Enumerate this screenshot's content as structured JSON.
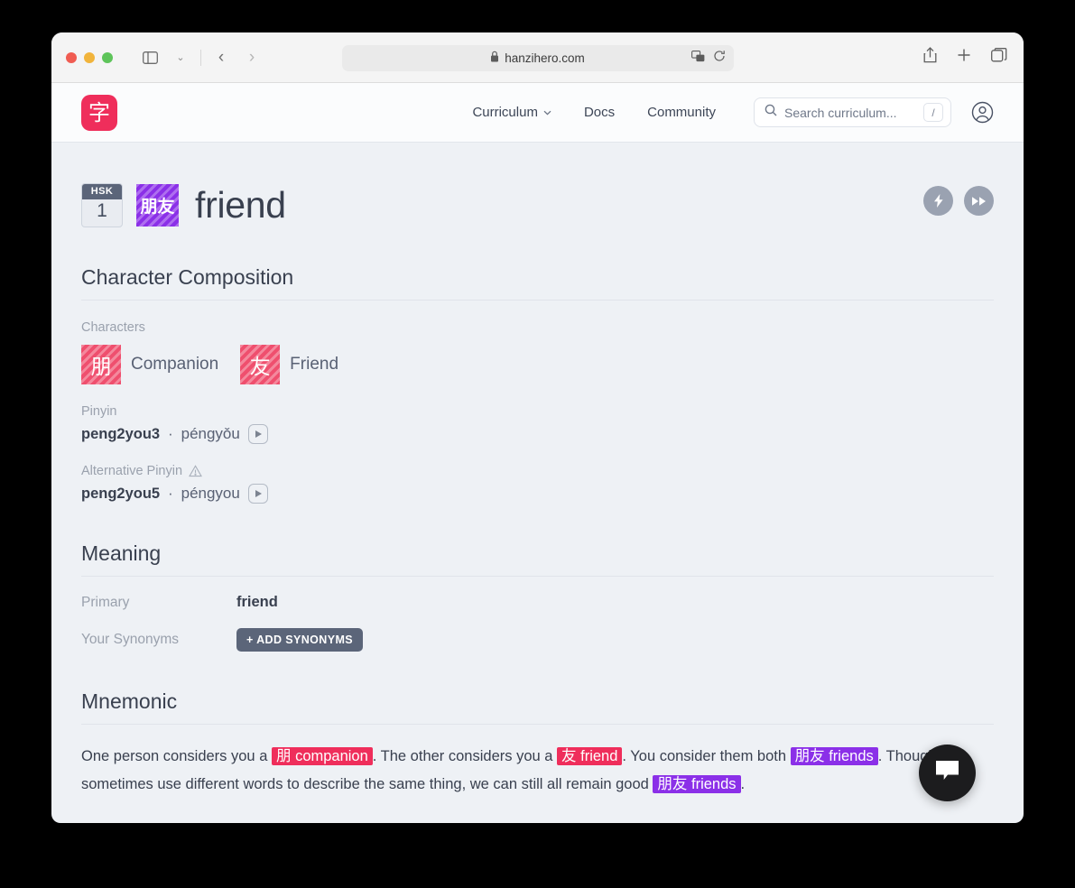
{
  "browser": {
    "url": "hanzihero.com",
    "lock_icon": "lock-icon",
    "translate_icon": "translate-icon",
    "reload_icon": "reload-icon",
    "sidebar_icon": "sidebar-toggle-icon",
    "back_label": "‹",
    "forward_label": "›",
    "chevron_label": "⌄",
    "share_icon": "share-icon",
    "new_tab_icon": "plus-icon",
    "tabs_icon": "tab-overview-icon"
  },
  "site_header": {
    "logo_char": "字",
    "nav": [
      {
        "label": "Curriculum",
        "has_chevron": true
      },
      {
        "label": "Docs",
        "has_chevron": false
      },
      {
        "label": "Community",
        "has_chevron": false
      }
    ],
    "chevron": "⌄",
    "search": {
      "placeholder": "Search curriculum...",
      "kbd": "/"
    },
    "account_icon": "account-circle-icon"
  },
  "page": {
    "hsk": {
      "label": "HSK",
      "level": "1"
    },
    "word": "朋友",
    "title": "friend",
    "actions": [
      {
        "name": "quick-study-button",
        "icon": "lightning-bolt-icon"
      },
      {
        "name": "fast-forward-button",
        "icon": "fast-forward-icon"
      }
    ]
  },
  "composition": {
    "heading": "Character Composition",
    "characters_label": "Characters",
    "characters": [
      {
        "char": "朋",
        "gloss": "Companion"
      },
      {
        "char": "友",
        "gloss": "Friend"
      }
    ],
    "pinyin": {
      "label": "Pinyin",
      "code": "peng2you3",
      "separator": "·",
      "reading": "péngyǒu"
    },
    "alt_pinyin": {
      "label": "Alternative Pinyin",
      "warning_icon": "warning-triangle-icon",
      "code": "peng2you5",
      "separator": "·",
      "reading": "péngyou"
    }
  },
  "meaning": {
    "heading": "Meaning",
    "primary_label": "Primary",
    "primary_value": "friend",
    "synonyms_label": "Your Synonyms",
    "add_synonyms_button": "+ ADD SYNONYMS"
  },
  "mnemonic": {
    "heading": "Mnemonic",
    "p1_a": "One person considers you a ",
    "hl1_cn": "朋",
    "hl1_en": "companion",
    "p1_b": ". The other considers you a ",
    "hl2_cn": "友",
    "hl2_en": "friend",
    "p1_c": ". You consider them both ",
    "hl3_cn": "朋友",
    "hl3_en": "friends",
    "p1_d": ".",
    "p2_a": "Though we sometimes use different words to describe the same thing, we can still all remain good ",
    "hl4_cn": "朋友",
    "hl4_en": "friends",
    "p2_b": "."
  },
  "chat": {
    "icon": "chat-bubble-icon"
  },
  "colors": {
    "brand_red": "#ef2e5b",
    "char_tile_red": "#ef4f6e",
    "word_purple": "#8b30e8",
    "slate": "#5b6579",
    "page_bg": "#eef1f5"
  }
}
